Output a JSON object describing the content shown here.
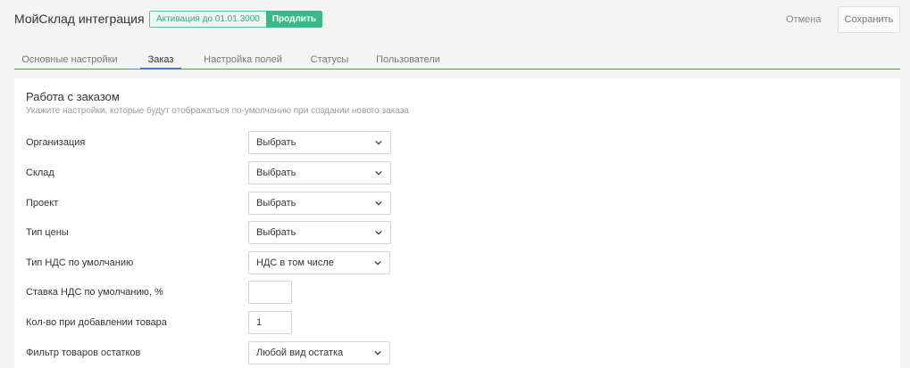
{
  "header": {
    "app_title": "МойСклад интеграция",
    "activation_text": "Активация до 01.01.3000",
    "extend_label": "Продлить",
    "cancel_label": "Отмена",
    "save_label": "Сохранить"
  },
  "tabs": [
    {
      "label": "Основные настройки",
      "active": false
    },
    {
      "label": "Заказ",
      "active": true
    },
    {
      "label": "Настройка полей",
      "active": false
    },
    {
      "label": "Статусы",
      "active": false
    },
    {
      "label": "Пользователи",
      "active": false
    }
  ],
  "section": {
    "title": "Работа с заказом",
    "subtitle": "Укажите настройки, которые будут отображаться по-умолчанию при создании нового заказа"
  },
  "fields": {
    "organization": {
      "label": "Организация",
      "value": "Выбрать"
    },
    "warehouse": {
      "label": "Склад",
      "value": "Выбрать"
    },
    "project": {
      "label": "Проект",
      "value": "Выбрать"
    },
    "price_type": {
      "label": "Тип цены",
      "value": "Выбрать"
    },
    "vat_type": {
      "label": "Тип НДС по умолчанию",
      "value": "НДС в том числе"
    },
    "vat_rate": {
      "label": "Ставка НДС по умолчанию, %",
      "value": ""
    },
    "add_quantity": {
      "label": "Кол-во при добавлении товара",
      "value": "1"
    },
    "stock_filter": {
      "label": "Фильтр товаров остатков",
      "value": "Любой вид остатка"
    }
  },
  "colors": {
    "accent": "#4a76c0",
    "badge_green": "#3bb98b"
  },
  "icons": {
    "dropdown": "chevron-down-icon"
  }
}
